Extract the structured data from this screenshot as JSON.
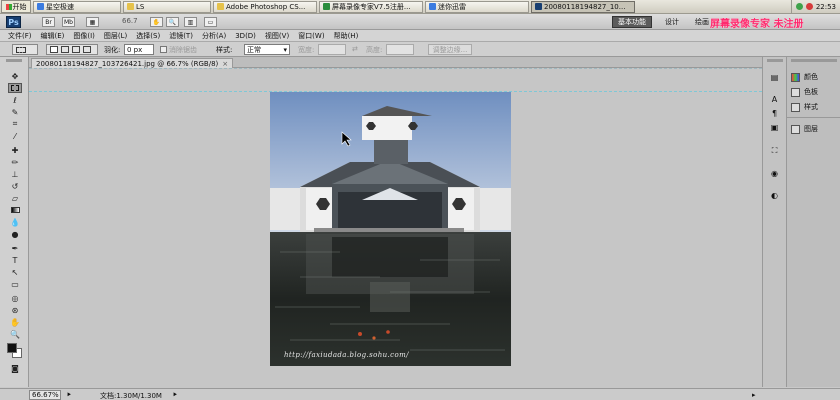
{
  "taskbar": {
    "start_label": "开始",
    "items": [
      {
        "label": "星空极速"
      },
      {
        "label": "LS"
      },
      {
        "label": "Adobe Photoshop CS..."
      },
      {
        "label": "屏幕录像专家V7.5注册..."
      },
      {
        "label": "迷你迅雷"
      },
      {
        "label": "20080118194827_10..."
      }
    ],
    "clock": "22:53"
  },
  "appbar": {
    "logo": "Ps",
    "zoom": "66.7",
    "workspaces": [
      "基本功能",
      "设计",
      "绘画"
    ],
    "active_workspace": "基本功能",
    "watermark": "屏幕录像专家 未注册"
  },
  "menu": [
    "文件(F)",
    "编辑(E)",
    "图像(I)",
    "图层(L)",
    "选择(S)",
    "滤镜(T)",
    "分析(A)",
    "3D(D)",
    "视图(V)",
    "窗口(W)",
    "帮助(H)"
  ],
  "options": {
    "feather_label": "羽化:",
    "feather_value": "0 px",
    "antialias_label": "消除锯齿",
    "style_label": "样式:",
    "style_value": "正常",
    "width_label": "宽度:",
    "height_label": "高度:",
    "refine_button": "调整边缘..."
  },
  "document": {
    "tab_title": "20080118194827_103726421.jpg @ 66.7% (RGB/8)",
    "tab_close": "×",
    "photo_caption": "http://faxiudada.blog.sohu.com/"
  },
  "panels": [
    {
      "label": "颜色"
    },
    {
      "label": "色板"
    },
    {
      "label": "样式"
    },
    {
      "label": "图层"
    }
  ],
  "status": {
    "zoom": "66.67%",
    "doc_info": "文档:1.30M/1.30M"
  },
  "colors": {
    "foreground": "#111111",
    "background": "#ffffff",
    "active_workspace_bg": "#5b5b5b",
    "watermark": "#ff2a6e"
  }
}
